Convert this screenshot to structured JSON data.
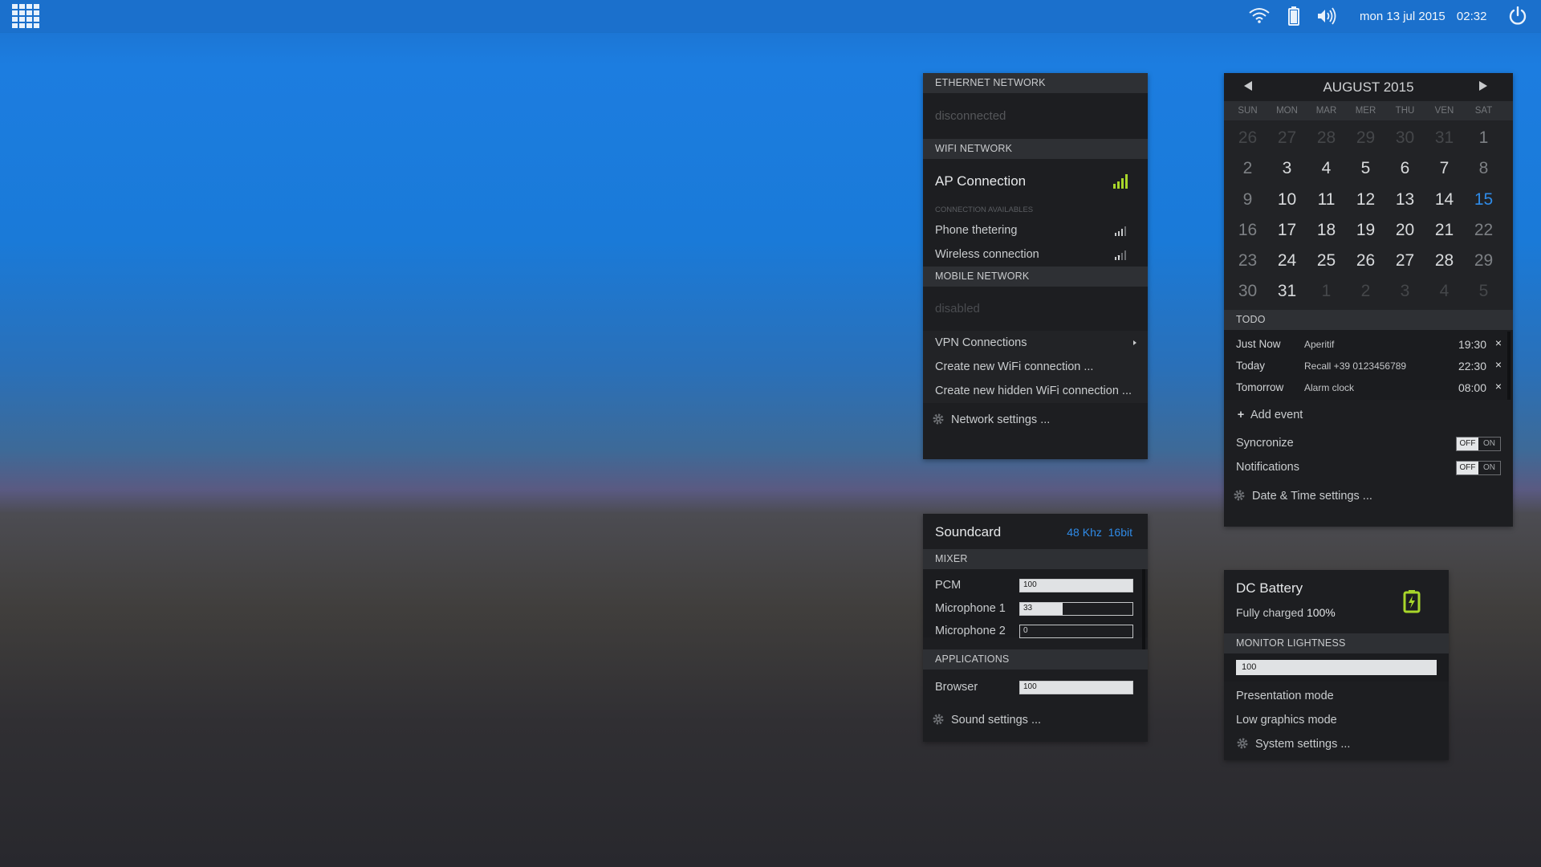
{
  "topbar": {
    "clock_date": "mon 13 jul 2015",
    "clock_time": "02:32"
  },
  "network": {
    "ethernet_header": "ETHERNET NETWORK",
    "ethernet_status": "disconnected",
    "wifi_header": "WIFI NETWORK",
    "active_connection": "AP Connection",
    "available_header": "CONNECTION AVAILABLES",
    "available": [
      "Phone thetering",
      "Wireless connection"
    ],
    "mobile_header": "MOBILE NETWORK",
    "mobile_status": "disabled",
    "vpn_label": "VPN Connections",
    "create_wifi": "Create new WiFi connection ...",
    "create_hidden_wifi": "Create new hidden WiFi connection ...",
    "settings": "Network settings ...",
    "signal_color": "#a8d62a"
  },
  "calendar": {
    "title": "AUGUST 2015",
    "weekdays": [
      "SUN",
      "MON",
      "MAR",
      "MER",
      "THU",
      "VEN",
      "SAT"
    ],
    "days": [
      [
        "26",
        "27",
        "28",
        "29",
        "30",
        "31",
        "1"
      ],
      [
        "2",
        "3",
        "4",
        "5",
        "6",
        "7",
        "8"
      ],
      [
        "9",
        "10",
        "11",
        "12",
        "13",
        "14",
        "15"
      ],
      [
        "16",
        "17",
        "18",
        "19",
        "20",
        "21",
        "22"
      ],
      [
        "23",
        "24",
        "25",
        "26",
        "27",
        "28",
        "29"
      ],
      [
        "30",
        "31",
        "1",
        "2",
        "3",
        "4",
        "5"
      ]
    ],
    "highlight_day": "15",
    "highlight_color": "#2f8ae6",
    "todo_header": "TODO",
    "todos": [
      {
        "when": "Just Now",
        "what": "Aperitif",
        "time": "19:30",
        "remove": "×"
      },
      {
        "when": "Today",
        "what": "Recall  +39 0123456789",
        "time": "22:30",
        "remove": "×"
      },
      {
        "when": "Tomorrow",
        "what": "Alarm clock",
        "time": "08:00",
        "remove": "×"
      }
    ],
    "add_event": "Add event",
    "sync_label": "Syncronize",
    "notif_label": "Notifications",
    "toggle_off": "OFF",
    "toggle_on": "ON",
    "settings": "Date & Time settings ..."
  },
  "sound": {
    "title": "Soundcard",
    "rate": "48 Khz",
    "bits": "16bit",
    "accent": "#2f8ae6",
    "mixer_header": "MIXER",
    "mixer": [
      {
        "label": "PCM",
        "value": "100",
        "level": 100
      },
      {
        "label": "Microphone 1",
        "value": "33",
        "level": 33
      },
      {
        "label": "Microphone 2",
        "value": "0",
        "level": 0
      }
    ],
    "apps_header": "APPLICATIONS",
    "apps": [
      {
        "label": "Browser",
        "value": "100",
        "level": 100
      }
    ],
    "settings": "Sound settings ..."
  },
  "battery": {
    "title": "DC Battery",
    "status_prefix": "Fully charged",
    "percent": "100%",
    "icon_color": "#a8d62a",
    "lightness_header": "MONITOR LIGHTNESS",
    "lightness": "100",
    "presentation": "Presentation mode",
    "low_graphics": "Low graphics mode",
    "settings": "System settings ..."
  }
}
